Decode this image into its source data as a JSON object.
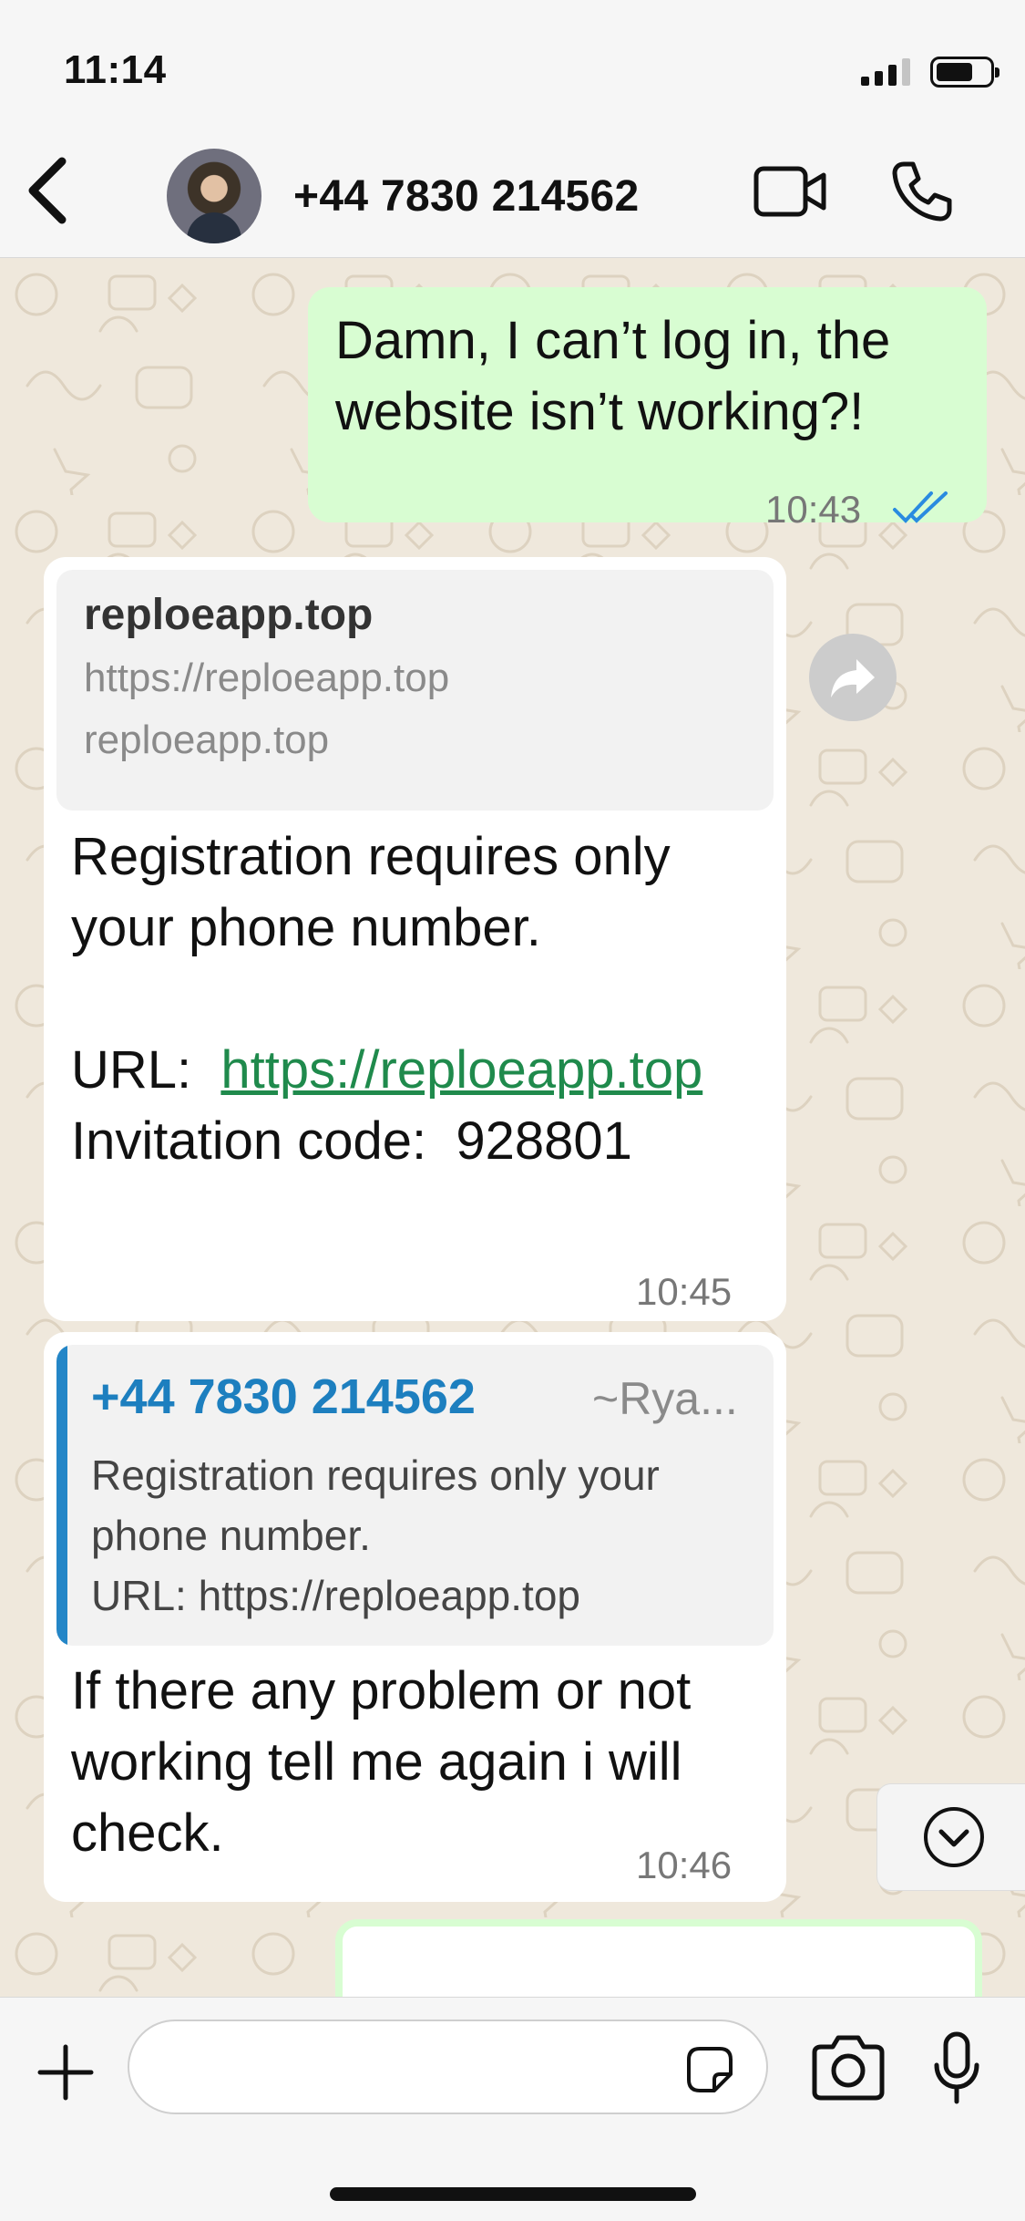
{
  "status_bar": {
    "time": "11:14"
  },
  "header": {
    "contact_name": "+44 7830 214562",
    "back_icon": "chevron-left-icon",
    "video_icon": "video-camera-icon",
    "call_icon": "phone-icon"
  },
  "messages": [
    {
      "direction": "outgoing",
      "text": "Damn, I can’t log in, the website isn’t working?!",
      "time": "10:43",
      "read_status": "read"
    },
    {
      "direction": "incoming",
      "link_preview": {
        "title": "reploeapp.top",
        "url": "https://reploeapp.top",
        "domain": "reploeapp.top"
      },
      "text_line1": "Registration requires only your phone number.",
      "url_label": "URL:",
      "url_link": "https://reploeapp.top",
      "code_label": "Invitation code:",
      "code_value": "928801",
      "time": "10:45"
    },
    {
      "direction": "incoming",
      "quote": {
        "name": "+44 7830 214562",
        "alias": "~Rya...",
        "text_line1": "Registration requires only your phone number.",
        "text_line2": "URL:  https://reploeapp.top"
      },
      "text": "If there any problem or not working tell me again i will check.",
      "time": "10:46"
    }
  ],
  "composer": {
    "placeholder": "",
    "plus_icon": "plus-icon",
    "sticker_icon": "sticker-icon",
    "camera_icon": "camera-icon",
    "mic_icon": "microphone-icon"
  },
  "colors": {
    "outgoing_bubble": "#d8fdd2",
    "incoming_bubble": "#ffffff",
    "link": "#1f8a4c",
    "quote_accent": "#2486c7",
    "read_ticks": "#2a8be0",
    "wallpaper": "#efe8dc"
  }
}
